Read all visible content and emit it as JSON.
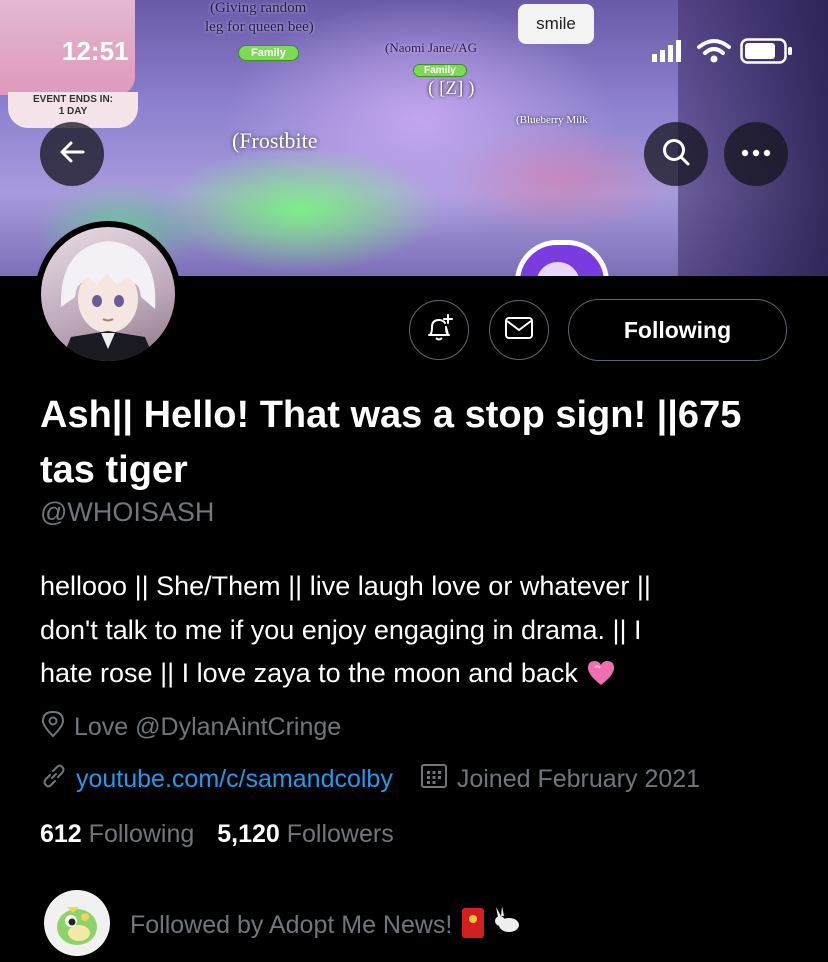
{
  "status_bar": {
    "time": "12:51"
  },
  "banner": {
    "event_line1": "EVENT ENDS IN:",
    "event_line2": "1 DAY",
    "tag_giving_1": "(Giving random",
    "tag_giving_2": "leg for queen bee)",
    "family_label_1": "Family",
    "tag_naomi": "(Naomi Jane//AG",
    "family_label_2": "Family",
    "tag_z": "( [Z] )",
    "tag_blueberry": "(Blueberry Milk",
    "tag_frostbite": "(Frostbite",
    "bubble_text": "smile"
  },
  "nav": {
    "back_icon": "arrow-left-icon",
    "search_icon": "search-icon",
    "more_icon": "more-horizontal-icon"
  },
  "actions": {
    "notify_icon": "bell-plus-icon",
    "message_icon": "envelope-icon",
    "following_label": "Following"
  },
  "profile": {
    "display_name": "Ash|| Hello! That was a stop sign! ||675 tas tiger",
    "handle": "@WHOISASH",
    "bio_line1": "hellooo || She/Them || live laugh love or whatever ||",
    "bio_line2": "don't talk to me if you enjoy engaging in drama. || I",
    "bio_line3": "hate rose || I love zaya to the moon and back",
    "location": "Love @DylanAintCringe",
    "website": "youtube.com/c/samandcolby",
    "joined": "Joined February 2021",
    "following_count": "612",
    "following_label": "Following",
    "followers_count": "5,120",
    "followers_label": "Followers",
    "followed_by": "Followed by Adopt Me News!"
  },
  "colors": {
    "background": "#000000",
    "text_primary": "#ffffff",
    "text_secondary": "#71767b",
    "link": "#1d9bf0",
    "border": "#5c6770"
  }
}
